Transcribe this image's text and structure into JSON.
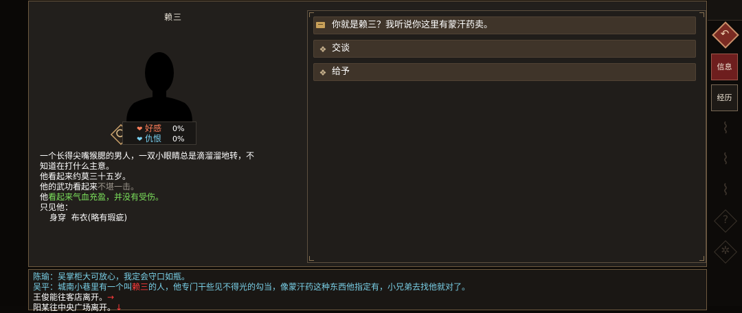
{
  "npc": {
    "name": "赖三",
    "relations": [
      {
        "label": "好感",
        "value": "0%"
      },
      {
        "label": "仇恨",
        "value": "0%"
      }
    ],
    "description": {
      "line1": "一个长得尖嘴猴腮的男人，一双小眼睛总是滴溜溜地转，不",
      "line2": "知道在打什么主意。",
      "line3": "他看起来约莫三十五岁。",
      "line4_prefix": "他的武功看起来",
      "line4_grey": "不堪一击。",
      "line5_prefix": "他",
      "line5_green": "看起来气血充盈，并没有受伤。",
      "line6": "只见他：",
      "equip_slot": "身穿",
      "equip_item": "布衣(略有瑕疵)"
    }
  },
  "dialog": {
    "options": [
      {
        "label": "你就是赖三？我听说你这里有蒙汗药卖。",
        "icon": "chat-icon"
      },
      {
        "label": "交谈",
        "icon": "diamond-icon"
      },
      {
        "label": "给予",
        "icon": "diamond-icon"
      }
    ]
  },
  "sidebar": {
    "info_label": "信息",
    "experience_label": "经历"
  },
  "log": {
    "line1": "陈瑜：吴掌柜大可放心，我定会守口如瓶。",
    "line2_prefix": "吴平：城南小巷里有一个叫",
    "line2_name": "赖三",
    "line2_suffix": "的人，他专门干些见不得光的勾当，像蒙汗药这种东西他指定有，小兄弟去找他就对了。",
    "line3_text": "王俊能往客店离开。",
    "line3_arrow": "→",
    "line4_text": "阳某往中央广场离开。",
    "line4_arrow": "↓"
  }
}
